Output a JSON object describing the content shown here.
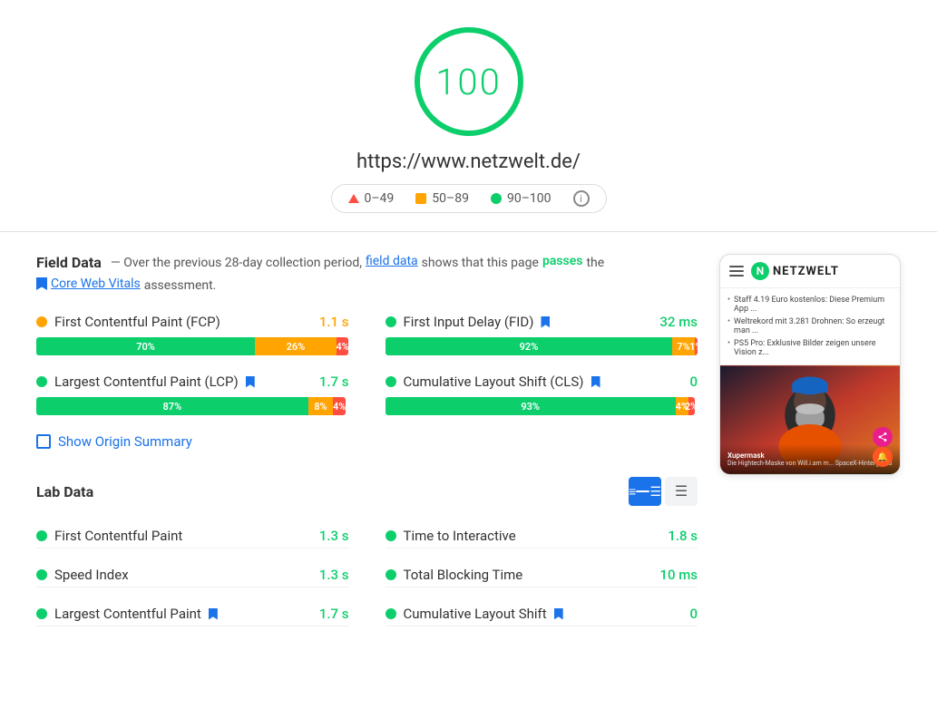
{
  "score": {
    "value": "100",
    "color": "#0cce6b"
  },
  "url": "https://www.netzwelt.de/",
  "legend": {
    "range1": "0–49",
    "range2": "50–89",
    "range3": "90–100"
  },
  "field_data": {
    "title": "Field Data",
    "description_prefix": " — Over the previous 28-day collection period, ",
    "field_data_link": "field data",
    "description_middle": " shows that this page ",
    "passes_text": "passes",
    "description_suffix": " the",
    "core_web_vitals_link": "Core Web Vitals",
    "assessment_text": " assessment."
  },
  "metrics": {
    "fcp": {
      "label": "First Contentful Paint (FCP)",
      "value": "1.1 s",
      "dot_type": "orange",
      "value_color": "orange",
      "bar": {
        "green": "70%",
        "orange": "26%",
        "red": "4%"
      }
    },
    "fid": {
      "label": "First Input Delay (FID)",
      "value": "32 ms",
      "dot_type": "green",
      "value_color": "green",
      "has_bookmark": true,
      "bar": {
        "green": "92%",
        "orange": "7%",
        "red": "1%"
      }
    },
    "lcp": {
      "label": "Largest Contentful Paint (LCP)",
      "value": "1.7 s",
      "dot_type": "green",
      "value_color": "green",
      "has_bookmark": true,
      "bar": {
        "green": "87%",
        "orange": "8%",
        "red": "4%"
      }
    },
    "cls": {
      "label": "Cumulative Layout Shift (CLS)",
      "value": "0",
      "dot_type": "green",
      "value_color": "green",
      "has_bookmark": true,
      "bar": {
        "green": "93%",
        "orange": "4%",
        "red": "2%"
      }
    }
  },
  "show_origin_summary": "Show Origin Summary",
  "lab_data": {
    "title": "Lab Data",
    "metrics": [
      {
        "label": "First Contentful Paint",
        "value": "1.3 s",
        "color": "green"
      },
      {
        "label": "Time to Interactive",
        "value": "1.8 s",
        "color": "green"
      },
      {
        "label": "Speed Index",
        "value": "1.3 s",
        "color": "green"
      },
      {
        "label": "Total Blocking Time",
        "value": "10 ms",
        "color": "green"
      },
      {
        "label": "Largest Contentful Paint",
        "value": "1.7 s",
        "color": "green",
        "has_bookmark": true
      },
      {
        "label": "Cumulative Layout Shift",
        "value": "0",
        "color": "green",
        "has_bookmark": true
      }
    ]
  },
  "phone_preview": {
    "site_name": "NETZWELT",
    "news_items": [
      "Staff 4.19 Euro kostenlos: Diese Premium App ...",
      "Weltrekord mit 3.281 Drohnen: So erzeugt man ...",
      "PS5 Pro: Exklusive Bilder zeigen unsere Vision z..."
    ],
    "image_caption": "Xupermask",
    "image_subcaption": "Die Hightech-Maske von Will.i.am m... SpaceX-Hintergrund"
  }
}
